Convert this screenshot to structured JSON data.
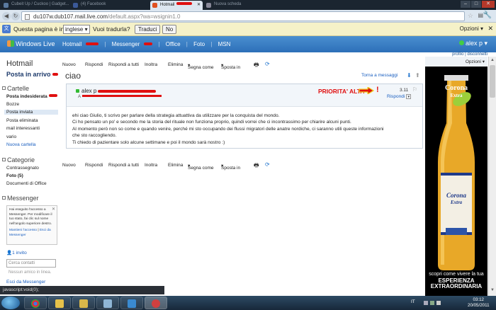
{
  "browser": {
    "tabs": [
      {
        "label": "Cubeit Up / Cuckoo | Gadget..."
      },
      {
        "label": "(4) Facebook"
      },
      {
        "label": "Hotmail"
      },
      {
        "label": "Nuova scheda"
      }
    ],
    "url_host": "du107w.dub107.mail.live.com",
    "url_path": "/default.aspx?wa=wsignin1.0"
  },
  "translate_bar": {
    "prefix": "Questa pagina è in",
    "language": "inglese",
    "question": "Vuoi tradurla?",
    "translate_button": "Traduci",
    "no_button": "No",
    "options": "Opzioni"
  },
  "header": {
    "brand": "Windows Live",
    "nav": [
      "Hotmail",
      "Messenger",
      "Office",
      "Foto",
      "MSN"
    ],
    "user": "alex p",
    "profile": "profilo",
    "logout": "disconnetti"
  },
  "sidebar": {
    "title": "Hotmail",
    "inbox": "Posta in arrivo",
    "folders_header": "Cartelle",
    "folders": [
      {
        "label": "Posta indesiderata"
      },
      {
        "label": "Bozze"
      },
      {
        "label": "Posta inviata"
      },
      {
        "label": "Posta eliminata"
      },
      {
        "label": "mail interessanti"
      },
      {
        "label": "vario"
      }
    ],
    "new_folder": "Nuova cartella",
    "categories_header": "Categorie",
    "categories": [
      {
        "label": "Contrassegnato"
      },
      {
        "label": "Foto (5)"
      },
      {
        "label": "Documenti di Office"
      }
    ],
    "messenger_header": "Messenger",
    "messenger_notice": "Hai eseguito l'accesso a Messenger. Per modificare il tuo stato, fai clic sul nome nell'angolo superiore destro.",
    "messenger_link1": "Mantieni l'accesso",
    "messenger_link2": "Esci da Messenger",
    "invite": "1 invito",
    "contacts_placeholder": "Cerca contatti",
    "no_online": "Nessun amico in linea.",
    "logout_messenger": "Esci da Messenger"
  },
  "toolbar": {
    "new": "Nuovo",
    "reply": "Rispondi",
    "reply_all": "Rispondi a tutti",
    "forward": "Inoltra",
    "delete": "Elimina",
    "mark_as": "Segna come",
    "move_to": "Sposta in"
  },
  "message": {
    "subject": "ciao",
    "back_link": "Torna a messaggi",
    "sender": "alex p",
    "to_label": "A",
    "priority": "PRIORITA' ALTA",
    "time": "3.11",
    "reply": "Rispondi",
    "body": [
      "ehi ciao Giulio, ti scrivo per parlare della strategia attuattiva da utilizzare per la conquista del mondo.",
      "Ci ho pensato un po' e secondo me la storia del rituale non funziona proprio, quindi vorrei che ci incontrassimo per chiarire alcuni punti.",
      "Al momento però non so come e quando venire, perché mi sto occupando dei flussi migratori delle anatre nordiche, ci saranno utili queste informazioni",
      "che sto raccogliendo.",
      "Ti chiedo di pazientare solo alcune settimane e poi il mondo sarà nostro :)"
    ]
  },
  "ad": {
    "options": "Opzioni",
    "brand": "Corona",
    "brand_sub": "Extra",
    "caption1": "scopri come vivere la tua",
    "caption2": "ESPERIENZA",
    "caption3": "EXTRAORDINARIA"
  },
  "status": "javascript:void(0);",
  "taskbar": {
    "lang": "IT",
    "time": "03:12",
    "date": "20/05/2011"
  },
  "colors": {
    "accent": "#2d6fb8",
    "redact": "#e01010",
    "link": "#1a5fc0"
  }
}
